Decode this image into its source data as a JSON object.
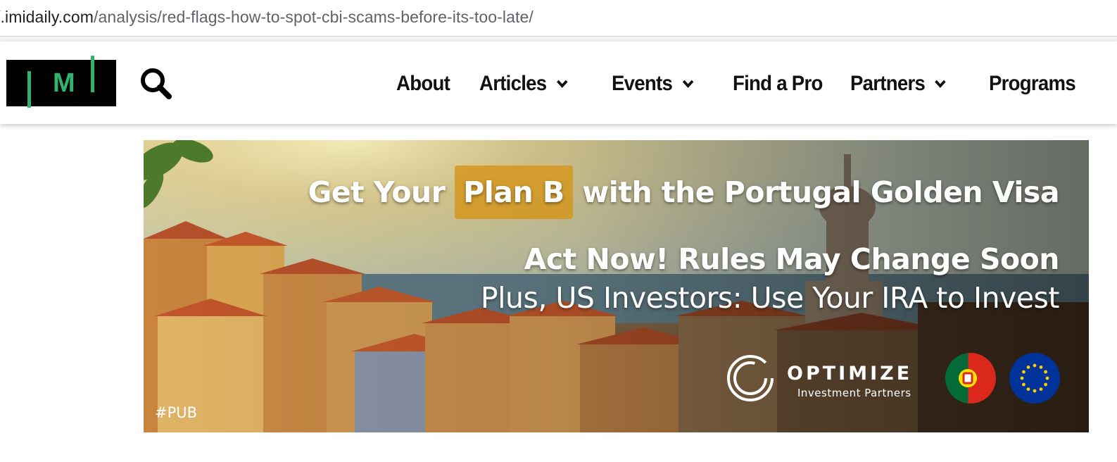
{
  "browser": {
    "url_prefix": "/.imidaily.com",
    "url_path": "/analysis/red-flags-how-to-spot-cbi-scams-before-its-too-late/"
  },
  "header": {
    "logo_text": "M",
    "nav": [
      {
        "label": "About",
        "has_dropdown": false
      },
      {
        "label": "Articles",
        "has_dropdown": true
      },
      {
        "label": "Events",
        "has_dropdown": true
      },
      {
        "label": "Find a Pro",
        "has_dropdown": false
      },
      {
        "label": "Partners",
        "has_dropdown": true
      },
      {
        "label": "Programs",
        "has_dropdown": false
      }
    ]
  },
  "banner": {
    "headline_pre": "Get Your ",
    "headline_highlight": "Plan B",
    "headline_post": " with the Portugal Golden Visa",
    "subhead": "Act Now! Rules May Change Soon",
    "tagline": "Plus, US Investors: Use Your IRA to Invest",
    "brand_name": "OPTIMIZE",
    "brand_sub": "Investment Partners",
    "ad_tag": "#PUB",
    "colors": {
      "highlight": "#d4961e",
      "logo_green": "#2fb36d",
      "pt_green": "#046a38",
      "pt_red": "#da291c",
      "eu_blue": "#003399"
    }
  }
}
